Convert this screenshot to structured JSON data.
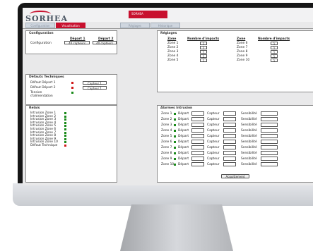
{
  "brand": "SORHEA",
  "header_label": "SORHEA",
  "tabs": [
    "Configuration",
    "Visualisation",
    "Réglages",
    "Historique"
  ],
  "config": {
    "title": "Configuration",
    "col1": "Départ 1",
    "col2": "Départ 2",
    "row_label": "Configuration",
    "val1": "40 capteurs",
    "val2": "40 capteurs"
  },
  "faults": {
    "title": "Défauts Techniques",
    "rows": [
      {
        "label": "Défaut Départ 1",
        "status": "red",
        "capteur": "Capteur 1"
      },
      {
        "label": "Défaut Départ 2",
        "status": "red",
        "capteur": "Capteur 1"
      },
      {
        "label": "Tension d'alimentation",
        "status": "green",
        "capteur": ""
      }
    ]
  },
  "relays": {
    "title": "Relais",
    "rows": [
      {
        "label": "Intrusion Zone 1",
        "status": "green"
      },
      {
        "label": "Intrusion Zone 2",
        "status": "green"
      },
      {
        "label": "Intrusion Zone 3",
        "status": "green"
      },
      {
        "label": "Intrusion Zone 4",
        "status": "green"
      },
      {
        "label": "Intrusion Zone 5",
        "status": "green"
      },
      {
        "label": "Intrusion Zone 6",
        "status": "green"
      },
      {
        "label": "Intrusion Zone 7",
        "status": "green"
      },
      {
        "label": "Intrusion Zone 8",
        "status": "green"
      },
      {
        "label": "Intrusion Zone 9",
        "status": "green"
      },
      {
        "label": "Intrusion Zone 10",
        "status": "green"
      },
      {
        "label": "Défaut Technique",
        "status": "red"
      }
    ]
  },
  "settings": {
    "title": "Réglages",
    "h_zone": "Zone",
    "h_impacts": "Nombre d'impacts",
    "left": [
      {
        "zone": "Zone 1",
        "impacts": "1"
      },
      {
        "zone": "Zone 2",
        "impacts": "1"
      },
      {
        "zone": "Zone 3",
        "impacts": "1"
      },
      {
        "zone": "Zone 4",
        "impacts": "1"
      },
      {
        "zone": "Zone 5",
        "impacts": "1"
      }
    ],
    "right": [
      {
        "zone": "Zone 6",
        "impacts": "1"
      },
      {
        "zone": "Zone 7",
        "impacts": "1"
      },
      {
        "zone": "Zone 8",
        "impacts": "1"
      },
      {
        "zone": "Zone 9",
        "impacts": "1"
      },
      {
        "zone": "Zone 10",
        "impacts": "1"
      }
    ]
  },
  "alarms": {
    "title": "Alarmes Intrusion",
    "depart_label": "Départ",
    "capteur_label": "Capteur",
    "sens_label": "Sensibilité",
    "rows": [
      {
        "zone": "Zone 1",
        "status": "green"
      },
      {
        "zone": "Zone 2",
        "status": "green"
      },
      {
        "zone": "Zone 3",
        "status": "green"
      },
      {
        "zone": "Zone 4",
        "status": "green"
      },
      {
        "zone": "Zone 5",
        "status": "green"
      },
      {
        "zone": "Zone 6",
        "status": "green"
      },
      {
        "zone": "Zone 7",
        "status": "green"
      },
      {
        "zone": "Zone 8",
        "status": "green"
      },
      {
        "zone": "Zone 9",
        "status": "green"
      },
      {
        "zone": "Zone 10",
        "status": "green"
      }
    ],
    "button": "Acquittement"
  },
  "colors": {
    "red": "#d01818",
    "green": "#1a8a1a",
    "brand": "#c8102e"
  }
}
